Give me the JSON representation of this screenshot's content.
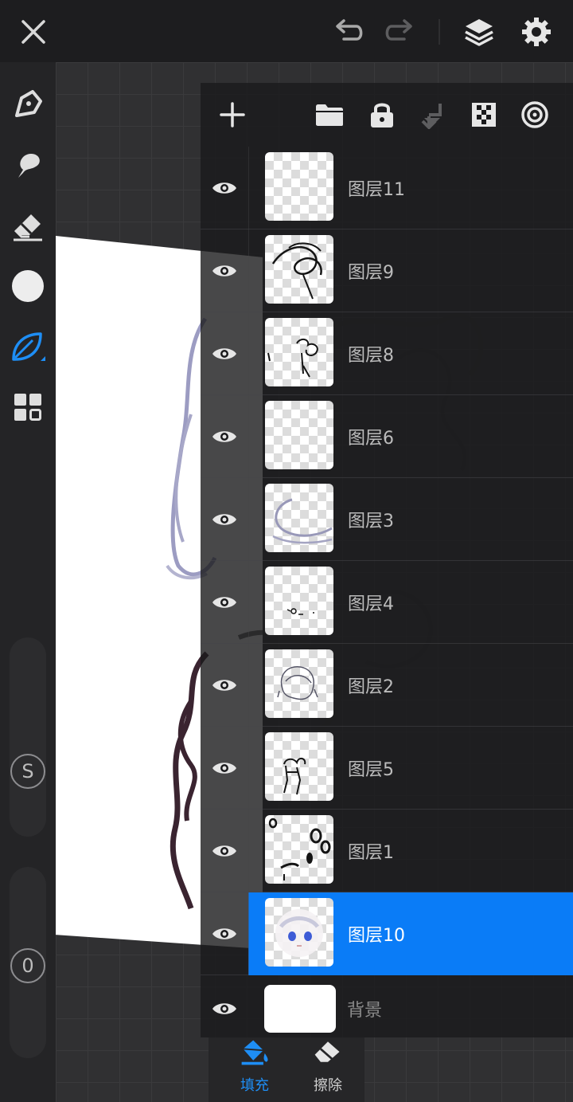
{
  "topbar": {
    "close_icon": "close-icon",
    "undo_icon": "undo-icon",
    "redo_icon": "redo-icon",
    "layers_icon": "layers-icon",
    "settings_icon": "gear-icon"
  },
  "left_toolbar": {
    "tools": [
      "pen-tool-icon",
      "smudge-tool-icon",
      "eraser-tool-icon",
      "color-swatch-icon",
      "brush-leaf-icon",
      "gallery-grid-icon"
    ],
    "active_tool": "brush-leaf-icon",
    "size_label": "S",
    "opacity_label": "0"
  },
  "layers_panel": {
    "header_icons": [
      "add-layer-icon",
      "folder-icon",
      "lock-icon",
      "merge-down-icon",
      "alpha-lock-icon",
      "blend-mode-icon"
    ],
    "layers": [
      {
        "name": "图层11",
        "visible": true,
        "selected": false
      },
      {
        "name": "图层9",
        "visible": true,
        "selected": false
      },
      {
        "name": "图层8",
        "visible": true,
        "selected": false
      },
      {
        "name": "图层6",
        "visible": true,
        "selected": false
      },
      {
        "name": "图层3",
        "visible": true,
        "selected": false
      },
      {
        "name": "图层4",
        "visible": true,
        "selected": false
      },
      {
        "name": "图层2",
        "visible": true,
        "selected": false
      },
      {
        "name": "图层5",
        "visible": true,
        "selected": false
      },
      {
        "name": "图层1",
        "visible": true,
        "selected": false
      },
      {
        "name": "图层10",
        "visible": true,
        "selected": true
      }
    ],
    "background_layer": {
      "name": "背景",
      "visible": true
    }
  },
  "bottom_tray": {
    "fill_label": "填充",
    "erase_label": "擦除"
  },
  "colors": {
    "accent": "#0a7cf7",
    "panel": "#1a1a1c",
    "background": "#1d1d1f"
  }
}
